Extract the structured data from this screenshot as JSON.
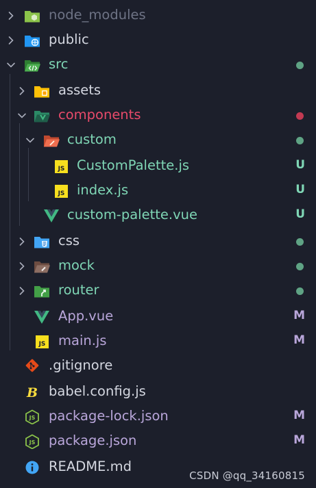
{
  "explorer": {
    "items": [
      {
        "name": "node_modules",
        "kind": "folder",
        "open": false,
        "icon": "node-modules-folder-icon",
        "icon_color": "#8bc34a",
        "text_color": "#6e7385"
      },
      {
        "name": "public",
        "kind": "folder",
        "open": false,
        "icon": "public-folder-icon",
        "icon_color": "#2196f3",
        "text_color": "#d4d7e0"
      },
      {
        "name": "src",
        "kind": "folder",
        "open": true,
        "icon": "src-folder-icon",
        "icon_color": "#4caf50",
        "text_color": "#7fd6b5"
      },
      {
        "name": "assets",
        "kind": "folder",
        "open": false,
        "icon": "assets-folder-icon",
        "icon_color": "#ffc107",
        "text_color": "#d4d7e0"
      },
      {
        "name": "components",
        "kind": "folder",
        "open": true,
        "icon": "components-folder-icon",
        "icon_color": "#42b883",
        "text_color": "#e84a6a"
      },
      {
        "name": "custom",
        "kind": "folder",
        "open": true,
        "icon": "custom-folder-icon",
        "icon_color": "#ef6e4f",
        "text_color": "#7fd6b5"
      },
      {
        "name": "CustomPalette.js",
        "kind": "file",
        "icon": "javascript-file-icon",
        "icon_color": "#f7df1e",
        "text_color": "#7fd6b5",
        "badge": "U"
      },
      {
        "name": "index.js",
        "kind": "file",
        "icon": "javascript-file-icon",
        "icon_color": "#f7df1e",
        "text_color": "#7fd6b5",
        "badge": "U"
      },
      {
        "name": "custom-palette.vue",
        "kind": "file",
        "icon": "vue-file-icon",
        "icon_color": "#42b883",
        "text_color": "#7fd6b5",
        "badge": "U"
      },
      {
        "name": "css",
        "kind": "folder",
        "open": false,
        "icon": "css-folder-icon",
        "icon_color": "#42a5f5",
        "text_color": "#d4d7e0"
      },
      {
        "name": "mock",
        "kind": "folder",
        "open": false,
        "icon": "mock-folder-icon",
        "icon_color": "#8d6e63",
        "text_color": "#7fd6b5"
      },
      {
        "name": "router",
        "kind": "folder",
        "open": false,
        "icon": "router-folder-icon",
        "icon_color": "#43a047",
        "text_color": "#7fd6b5"
      },
      {
        "name": "App.vue",
        "kind": "file",
        "icon": "vue-file-icon",
        "icon_color": "#42b883",
        "text_color": "#b9a6da",
        "badge": "M"
      },
      {
        "name": "main.js",
        "kind": "file",
        "icon": "javascript-file-icon",
        "icon_color": "#f7df1e",
        "text_color": "#b9a6da",
        "badge": "M"
      },
      {
        "name": ".gitignore",
        "kind": "file",
        "icon": "git-file-icon",
        "icon_color": "#e64a19",
        "text_color": "#d4d7e0"
      },
      {
        "name": "babel.config.js",
        "kind": "file",
        "icon": "babel-file-icon",
        "icon_color": "#f9dc3e",
        "text_color": "#d4d7e0"
      },
      {
        "name": "package-lock.json",
        "kind": "file",
        "icon": "nodejs-file-icon",
        "icon_color": "#8bc34a",
        "text_color": "#b9a6da",
        "badge": "M"
      },
      {
        "name": "package.json",
        "kind": "file",
        "icon": "nodejs-file-icon",
        "icon_color": "#8bc34a",
        "text_color": "#b9a6da",
        "badge": "M"
      },
      {
        "name": "README.md",
        "kind": "file",
        "icon": "info-file-icon",
        "icon_color": "#42a5f5",
        "text_color": "#d4d7e0"
      }
    ]
  },
  "colors": {
    "background": "#1c1f2b",
    "chevron": "#a9adbb",
    "dot_untracked": "#5fa384",
    "dot_error": "#c23a52",
    "badge_untracked": "#7fd6b5",
    "badge_modified": "#b9a6da"
  },
  "watermark": "CSDN @qq_34160815"
}
